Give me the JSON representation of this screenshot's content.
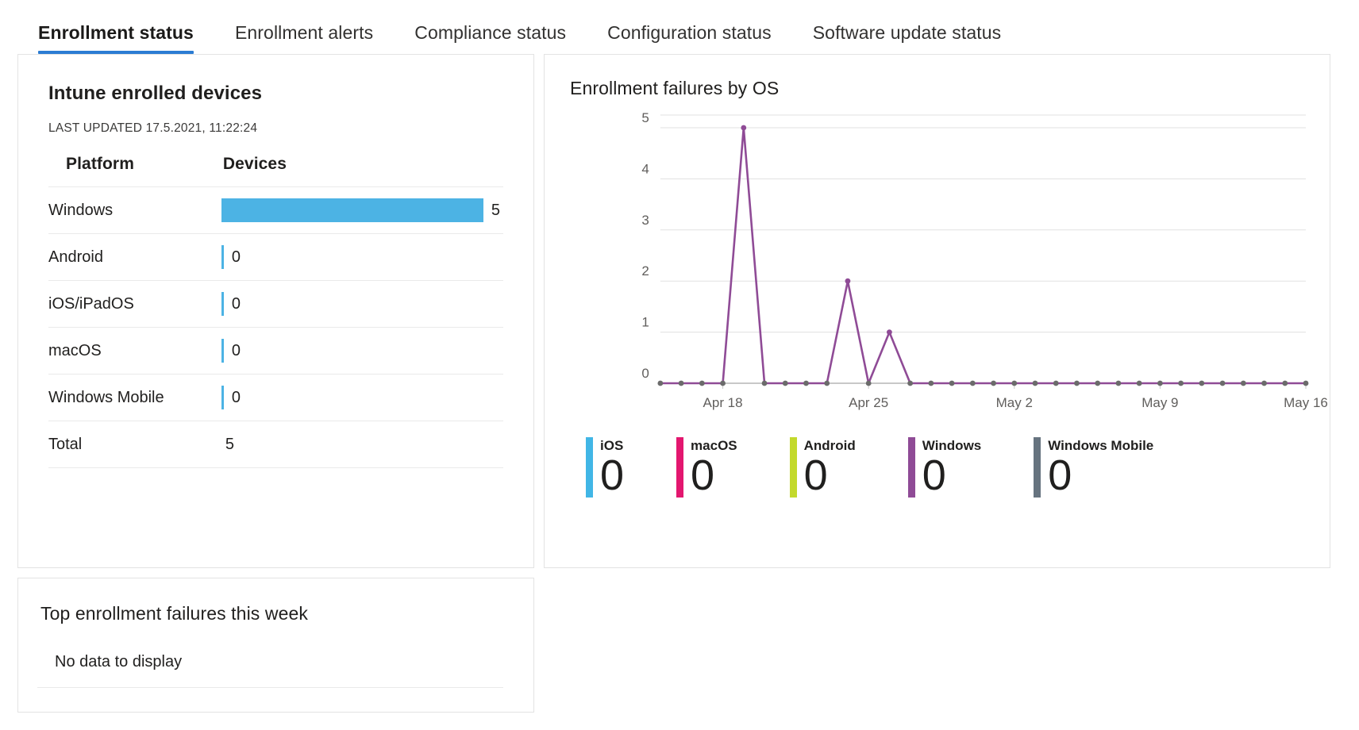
{
  "tabs": [
    {
      "label": "Enrollment status",
      "active": true
    },
    {
      "label": "Enrollment alerts",
      "active": false
    },
    {
      "label": "Compliance status",
      "active": false
    },
    {
      "label": "Configuration status",
      "active": false
    },
    {
      "label": "Software update status",
      "active": false
    }
  ],
  "devices_card": {
    "title": "Intune enrolled devices",
    "last_updated": "LAST UPDATED 17.5.2021, 11:22:24",
    "columns": [
      "Platform",
      "Devices"
    ],
    "rows": [
      {
        "platform": "Windows",
        "value": 5
      },
      {
        "platform": "Android",
        "value": 0
      },
      {
        "platform": "iOS/iPadOS",
        "value": 0
      },
      {
        "platform": "macOS",
        "value": 0
      },
      {
        "platform": "Windows Mobile",
        "value": 0
      }
    ],
    "total_label": "Total",
    "total_value": 5,
    "bar_color": "#4cb3e4",
    "bar_max": 5
  },
  "chart_card": {
    "title": "Enrollment failures by OS",
    "legend": [
      {
        "label": "iOS",
        "value": "0",
        "color": "#41b6e6"
      },
      {
        "label": "macOS",
        "value": "0",
        "color": "#e3176f"
      },
      {
        "label": "Android",
        "value": "0",
        "color": "#c3d92c"
      },
      {
        "label": "Windows",
        "value": "0",
        "color": "#8f4b96"
      },
      {
        "label": "Windows Mobile",
        "value": "0",
        "color": "#66737f"
      }
    ]
  },
  "chart_data": {
    "type": "line",
    "title": "Enrollment failures by OS",
    "xlabel": "",
    "ylabel": "",
    "ylim": [
      0,
      5
    ],
    "yticks": [
      0,
      1,
      2,
      3,
      4,
      5
    ],
    "grid": true,
    "legend_position": "bottom",
    "x_tick_labels": [
      "Apr 18",
      "Apr 25",
      "May 2",
      "May 9",
      "May 16"
    ],
    "x_tick_indices": [
      3,
      10,
      17,
      24,
      31
    ],
    "x": [
      "Apr 15",
      "Apr 16",
      "Apr 17",
      "Apr 18",
      "Apr 19",
      "Apr 20",
      "Apr 21",
      "Apr 22",
      "Apr 23",
      "Apr 24",
      "Apr 25",
      "Apr 26",
      "Apr 27",
      "Apr 28",
      "Apr 29",
      "Apr 30",
      "May 1",
      "May 2",
      "May 3",
      "May 4",
      "May 5",
      "May 6",
      "May 7",
      "May 8",
      "May 9",
      "May 10",
      "May 11",
      "May 12",
      "May 13",
      "May 14",
      "May 15",
      "May 16"
    ],
    "series": [
      {
        "name": "Windows",
        "color": "#8f4b96",
        "values": [
          0,
          0,
          0,
          0,
          5,
          0,
          0,
          0,
          0,
          2,
          0,
          1,
          0,
          0,
          0,
          0,
          0,
          0,
          0,
          0,
          0,
          0,
          0,
          0,
          0,
          0,
          0,
          0,
          0,
          0,
          0,
          0
        ]
      }
    ],
    "legend_entries": [
      {
        "name": "iOS",
        "color": "#41b6e6",
        "total": 0
      },
      {
        "name": "macOS",
        "color": "#e3176f",
        "total": 0
      },
      {
        "name": "Android",
        "color": "#c3d92c",
        "total": 0
      },
      {
        "name": "Windows",
        "color": "#8f4b96",
        "total": 0
      },
      {
        "name": "Windows Mobile",
        "color": "#66737f",
        "total": 0
      }
    ]
  },
  "topfail_card": {
    "title": "Top enrollment failures this week",
    "empty_message": "No data to display"
  }
}
